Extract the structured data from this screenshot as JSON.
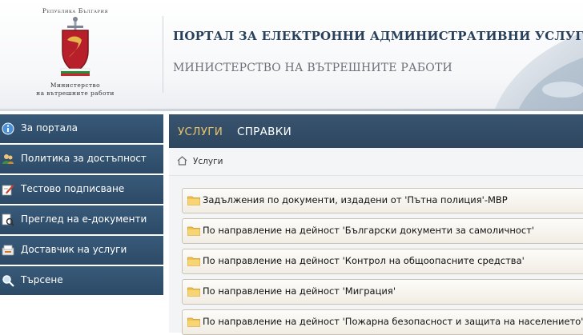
{
  "header": {
    "logo_top": "Република България",
    "logo_bottom_line1": "Министерство",
    "logo_bottom_line2": "на вътрешните работи",
    "portal_title": "ПОРТАЛ ЗА ЕЛЕКТРОННИ АДМИНИСТРАТИВНИ УСЛУГИ",
    "ministry_title": "МИНИСТЕРСТВО НА ВЪТРЕШНИТЕ РАБОТИ"
  },
  "sidebar": {
    "items": [
      {
        "label": "За портала",
        "icon": "info-icon"
      },
      {
        "label": "Политика за достъпност",
        "icon": "users-icon"
      },
      {
        "label": "Тестово подписване",
        "icon": "sign-document-icon"
      },
      {
        "label": "Преглед на е-документи",
        "icon": "document-view-icon"
      },
      {
        "label": "Доставчик на услуги",
        "icon": "provider-icon"
      },
      {
        "label": "Търсене",
        "icon": "magnifier-icon"
      }
    ]
  },
  "topnav": {
    "services": "УСЛУГИ",
    "reports": "СПРАВКИ"
  },
  "breadcrumb": {
    "current": "Услуги"
  },
  "folders": [
    "Задължения по документи, издадени от 'Пътна полиция'-МВР",
    "По направление на дейност 'Български документи за самоличност'",
    "По направление на дейност 'Контрол на общоопасните средства'",
    "По направление на дейност 'Миграция'",
    "По направление на дейност 'Пожарна безопасност и защита на населението'"
  ],
  "colors": {
    "sidebar_bg": "#2f4e6c",
    "topnav_bg": "#344d68",
    "active_nav": "#e8c46a",
    "title": "#29405a"
  }
}
